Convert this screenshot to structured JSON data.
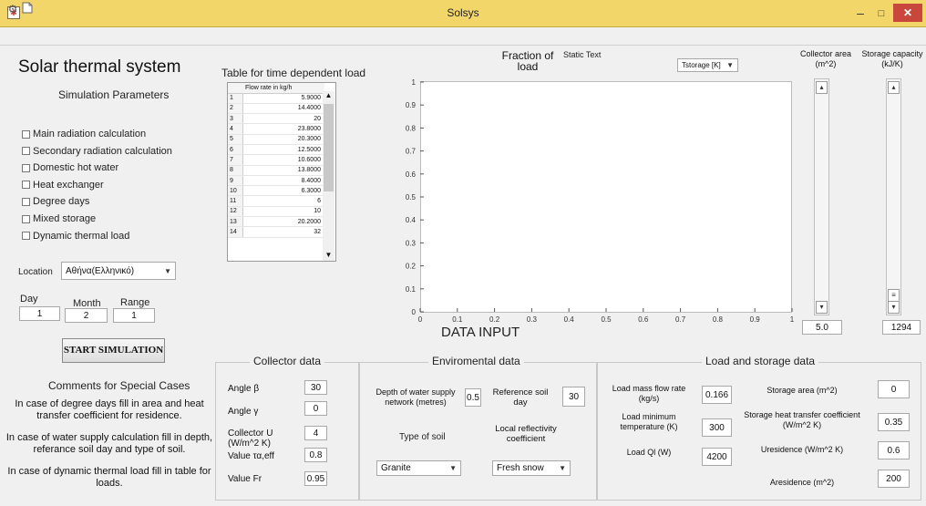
{
  "window": {
    "title": "Solsys",
    "min": "–",
    "max": "□",
    "close": "✕",
    "app_icon": "app-icon"
  },
  "toolbar": {
    "icons": [
      "gear-icon",
      "new-document-icon"
    ]
  },
  "header": {
    "title": "Solar thermal system",
    "subtitle": "Simulation Parameters"
  },
  "options": [
    {
      "label": "Main radiation calculation",
      "checked": false
    },
    {
      "label": "Secondary radiation calculation",
      "checked": false
    },
    {
      "label": "Domestic hot water",
      "checked": false
    },
    {
      "label": "Heat exchanger",
      "checked": false
    },
    {
      "label": "Degree days",
      "checked": false
    },
    {
      "label": "Mixed storage",
      "checked": false
    },
    {
      "label": "Dynamic thermal load",
      "checked": false
    }
  ],
  "location": {
    "label": "Location",
    "value": "Αθήνα(Ελληνικό)"
  },
  "date": {
    "day_label": "Day",
    "day": "1",
    "month_label": "Month",
    "month": "2",
    "range_label": "Range",
    "range": "1"
  },
  "start_button": "START SIMULATION",
  "comments": {
    "title": "Comments for Special Cases",
    "lines": [
      "In case of degree days fill in area and heat transfer coefficient for residence.",
      "In case of water supply calculation fill in depth, referance soil day and type of soil.",
      "In case of dynamic thermal load fill in table for loads."
    ]
  },
  "load_table": {
    "title": "Table for time dependent load",
    "column": "Flow rate in kg/h",
    "rows": [
      [
        "1",
        "5.9000"
      ],
      [
        "2",
        "14.4000"
      ],
      [
        "3",
        "20"
      ],
      [
        "4",
        "23.8000"
      ],
      [
        "5",
        "20.3000"
      ],
      [
        "6",
        "12.5000"
      ],
      [
        "7",
        "10.6000"
      ],
      [
        "8",
        "13.8000"
      ],
      [
        "9",
        "8.4000"
      ],
      [
        "10",
        "6.3000"
      ],
      [
        "11",
        "6"
      ],
      [
        "12",
        "10"
      ],
      [
        "13",
        "20.2000"
      ],
      [
        "14",
        "32"
      ]
    ]
  },
  "plot": {
    "label_line1": "Fraction of",
    "label_line2": "load",
    "static_text": "Static Text",
    "dropdown": "Tstorage [K]",
    "section_label": "DATA INPUT",
    "yticks": [
      "0",
      "0.1",
      "0.2",
      "0.3",
      "0.4",
      "0.5",
      "0.6",
      "0.7",
      "0.8",
      "0.9",
      "1"
    ],
    "xticks": [
      "0",
      "0.1",
      "0.2",
      "0.3",
      "0.4",
      "0.5",
      "0.6",
      "0.7",
      "0.8",
      "0.9",
      "1"
    ]
  },
  "collector_area": {
    "label_line1": "Collector area",
    "label_line2": "(m^2)",
    "value": "5.0",
    "slider_fraction": 0.0
  },
  "storage_capacity": {
    "label_line1": "Storage capacity",
    "label_line2": "(kJ/K)",
    "value": "1294",
    "slider_fraction": 0.0
  },
  "collector_data": {
    "title": "Collector data",
    "fields": [
      {
        "label": "Angle β",
        "value": "30"
      },
      {
        "label": "Angle γ",
        "value": "0"
      },
      {
        "label": "Collector U (W/m^2 K)",
        "value": "4"
      },
      {
        "label": "Value τα,eff",
        "value": "0.8"
      },
      {
        "label": "Value Fr",
        "value": "0.95"
      }
    ]
  },
  "environmental_data": {
    "title": "Enviromental data",
    "depth_label": "Depth of water supply network (metres)",
    "depth": "0.5",
    "refday_label": "Reference soil day",
    "refday": "30",
    "soil_label": "Type of soil",
    "soil": "Granite",
    "reflect_label": "Local reflectivity coefficient",
    "reflect": "Fresh snow"
  },
  "load_storage": {
    "title": "Load and storage data",
    "left": [
      {
        "label": "Load mass flow rate (kg/s)",
        "value": "0.166"
      },
      {
        "label": "Load minimum temperature (K)",
        "value": "300"
      },
      {
        "label": "Load Ql (W)",
        "value": "4200"
      }
    ],
    "right": [
      {
        "label": "Storage area (m^2)",
        "value": "0"
      },
      {
        "label": "Storage heat transfer coefficient (W/m^2 K)",
        "value": "0.35"
      },
      {
        "label": "Uresidence (W/m^2 K)",
        "value": "0.6"
      },
      {
        "label": "Aresidence (m^2)",
        "value": "200"
      }
    ]
  }
}
